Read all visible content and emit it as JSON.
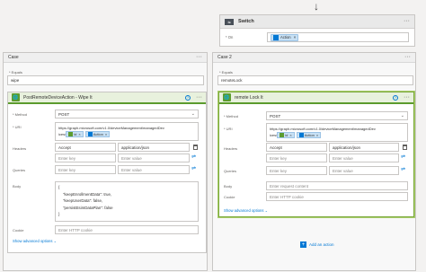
{
  "switch": {
    "title": "Switch",
    "on_label": "* On",
    "on_token": "Action"
  },
  "left": {
    "case_title": "Case",
    "equals_label": "* Equals",
    "equals_value": "wipe",
    "action": {
      "title": "PostRemoteDeviceAction - Wipe It",
      "method_label": "* Method",
      "method_value": "POST",
      "uri_label": "* URI",
      "uri_text": "https://graph.microsoft.com/v1.0/deviceManagement/managedDev",
      "uri_prefix": "ices/",
      "uri_token1": "id",
      "uri_token2": "Action",
      "headers_label": "Headers",
      "header_key": "Accept",
      "header_value": "application/json",
      "key_placeholder": "Enter key",
      "value_placeholder": "Enter value",
      "queries_label": "Queries",
      "body_label": "Body",
      "body_lines": [
        "{",
        "  \"keepEnrollmentData\": true,",
        "  \"keepUserData\": false,",
        "  \"persistEsimDataPlan\": false",
        "}"
      ],
      "cookie_label": "Cookie",
      "cookie_placeholder": "Enter HTTP cookie",
      "show_advanced": "Show advanced options"
    }
  },
  "right": {
    "case_title": "Case 2",
    "equals_label": "* Equals",
    "equals_value": "remoteLock",
    "action": {
      "title": "remote Lock It",
      "method_label": "* Method",
      "method_value": "POST",
      "uri_label": "* URI",
      "uri_text": "https://graph.microsoft.com/v1.0/deviceManagement/managedDev",
      "uri_prefix": "ices/",
      "uri_token1": "id",
      "uri_token2": "Action",
      "headers_label": "Headers",
      "header_key": "Accept",
      "header_value": "application/json",
      "key_placeholder": "Enter key",
      "value_placeholder": "Enter value",
      "queries_label": "Queries",
      "body_label": "Body",
      "body_placeholder": "Enter request content",
      "cookie_label": "Cookie",
      "cookie_placeholder": "Enter HTTP cookie",
      "show_advanced": "Show advanced options"
    },
    "add_action": "Add an action"
  },
  "dots": "···",
  "chevron": "⌄",
  "arrow": "↓",
  "colors": {
    "accent": "#0078d4",
    "green": "#5c9c2f"
  }
}
